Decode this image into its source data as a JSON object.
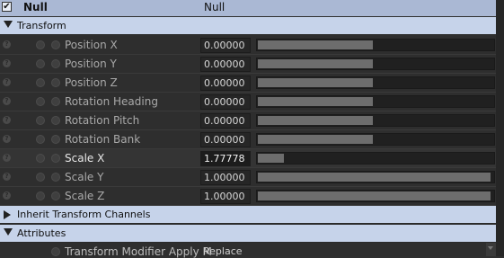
{
  "header": {
    "checkbox_glyph": "✔",
    "name": "Null",
    "type": "Null"
  },
  "sections": {
    "transform": "Transform",
    "inherit": "Inherit Transform Channels",
    "attributes": "Attributes"
  },
  "help_glyph": "?",
  "params": [
    {
      "label": "Position X",
      "value": "0.00000",
      "slider_fraction": 0.49
    },
    {
      "label": "Position Y",
      "value": "0.00000",
      "slider_fraction": 0.49
    },
    {
      "label": "Position Z",
      "value": "0.00000",
      "slider_fraction": 0.49
    },
    {
      "label": "Rotation Heading",
      "value": "0.00000",
      "slider_fraction": 0.49
    },
    {
      "label": "Rotation Pitch",
      "value": "0.00000",
      "slider_fraction": 0.49
    },
    {
      "label": "Rotation Bank",
      "value": "0.00000",
      "slider_fraction": 0.49
    },
    {
      "label": "Scale X",
      "value": "1.77778",
      "slider_fraction": 0.11,
      "active": true
    },
    {
      "label": "Scale Y",
      "value": "1.00000",
      "slider_fraction": 0.99
    },
    {
      "label": "Scale Z",
      "value": "1.00000",
      "slider_fraction": 0.99
    }
  ],
  "attributes_row": {
    "label": "Transform Modifier Apply M",
    "value": "Replace"
  },
  "colors": {
    "header": "#aab8d4",
    "section": "#c6d3ea",
    "slider_fill": "#6d6d6d"
  }
}
